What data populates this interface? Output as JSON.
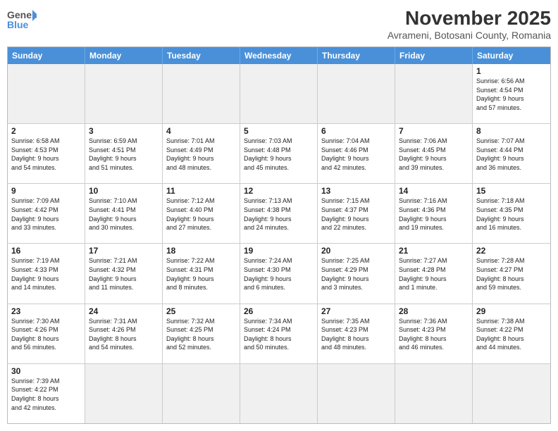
{
  "header": {
    "logo_general": "General",
    "logo_blue": "Blue",
    "title": "November 2025",
    "subtitle": "Avrameni, Botosani County, Romania"
  },
  "weekdays": [
    "Sunday",
    "Monday",
    "Tuesday",
    "Wednesday",
    "Thursday",
    "Friday",
    "Saturday"
  ],
  "cells": [
    {
      "day": "",
      "info": "",
      "empty": true
    },
    {
      "day": "",
      "info": "",
      "empty": true
    },
    {
      "day": "",
      "info": "",
      "empty": true
    },
    {
      "day": "",
      "info": "",
      "empty": true
    },
    {
      "day": "",
      "info": "",
      "empty": true
    },
    {
      "day": "",
      "info": "",
      "empty": true
    },
    {
      "day": "1",
      "info": "Sunrise: 6:56 AM\nSunset: 4:54 PM\nDaylight: 9 hours\nand 57 minutes.",
      "empty": false
    },
    {
      "day": "2",
      "info": "Sunrise: 6:58 AM\nSunset: 4:53 PM\nDaylight: 9 hours\nand 54 minutes.",
      "empty": false
    },
    {
      "day": "3",
      "info": "Sunrise: 6:59 AM\nSunset: 4:51 PM\nDaylight: 9 hours\nand 51 minutes.",
      "empty": false
    },
    {
      "day": "4",
      "info": "Sunrise: 7:01 AM\nSunset: 4:49 PM\nDaylight: 9 hours\nand 48 minutes.",
      "empty": false
    },
    {
      "day": "5",
      "info": "Sunrise: 7:03 AM\nSunset: 4:48 PM\nDaylight: 9 hours\nand 45 minutes.",
      "empty": false
    },
    {
      "day": "6",
      "info": "Sunrise: 7:04 AM\nSunset: 4:46 PM\nDaylight: 9 hours\nand 42 minutes.",
      "empty": false
    },
    {
      "day": "7",
      "info": "Sunrise: 7:06 AM\nSunset: 4:45 PM\nDaylight: 9 hours\nand 39 minutes.",
      "empty": false
    },
    {
      "day": "8",
      "info": "Sunrise: 7:07 AM\nSunset: 4:44 PM\nDaylight: 9 hours\nand 36 minutes.",
      "empty": false
    },
    {
      "day": "9",
      "info": "Sunrise: 7:09 AM\nSunset: 4:42 PM\nDaylight: 9 hours\nand 33 minutes.",
      "empty": false
    },
    {
      "day": "10",
      "info": "Sunrise: 7:10 AM\nSunset: 4:41 PM\nDaylight: 9 hours\nand 30 minutes.",
      "empty": false
    },
    {
      "day": "11",
      "info": "Sunrise: 7:12 AM\nSunset: 4:40 PM\nDaylight: 9 hours\nand 27 minutes.",
      "empty": false
    },
    {
      "day": "12",
      "info": "Sunrise: 7:13 AM\nSunset: 4:38 PM\nDaylight: 9 hours\nand 24 minutes.",
      "empty": false
    },
    {
      "day": "13",
      "info": "Sunrise: 7:15 AM\nSunset: 4:37 PM\nDaylight: 9 hours\nand 22 minutes.",
      "empty": false
    },
    {
      "day": "14",
      "info": "Sunrise: 7:16 AM\nSunset: 4:36 PM\nDaylight: 9 hours\nand 19 minutes.",
      "empty": false
    },
    {
      "day": "15",
      "info": "Sunrise: 7:18 AM\nSunset: 4:35 PM\nDaylight: 9 hours\nand 16 minutes.",
      "empty": false
    },
    {
      "day": "16",
      "info": "Sunrise: 7:19 AM\nSunset: 4:33 PM\nDaylight: 9 hours\nand 14 minutes.",
      "empty": false
    },
    {
      "day": "17",
      "info": "Sunrise: 7:21 AM\nSunset: 4:32 PM\nDaylight: 9 hours\nand 11 minutes.",
      "empty": false
    },
    {
      "day": "18",
      "info": "Sunrise: 7:22 AM\nSunset: 4:31 PM\nDaylight: 9 hours\nand 8 minutes.",
      "empty": false
    },
    {
      "day": "19",
      "info": "Sunrise: 7:24 AM\nSunset: 4:30 PM\nDaylight: 9 hours\nand 6 minutes.",
      "empty": false
    },
    {
      "day": "20",
      "info": "Sunrise: 7:25 AM\nSunset: 4:29 PM\nDaylight: 9 hours\nand 3 minutes.",
      "empty": false
    },
    {
      "day": "21",
      "info": "Sunrise: 7:27 AM\nSunset: 4:28 PM\nDaylight: 9 hours\nand 1 minute.",
      "empty": false
    },
    {
      "day": "22",
      "info": "Sunrise: 7:28 AM\nSunset: 4:27 PM\nDaylight: 8 hours\nand 59 minutes.",
      "empty": false
    },
    {
      "day": "23",
      "info": "Sunrise: 7:30 AM\nSunset: 4:26 PM\nDaylight: 8 hours\nand 56 minutes.",
      "empty": false
    },
    {
      "day": "24",
      "info": "Sunrise: 7:31 AM\nSunset: 4:26 PM\nDaylight: 8 hours\nand 54 minutes.",
      "empty": false
    },
    {
      "day": "25",
      "info": "Sunrise: 7:32 AM\nSunset: 4:25 PM\nDaylight: 8 hours\nand 52 minutes.",
      "empty": false
    },
    {
      "day": "26",
      "info": "Sunrise: 7:34 AM\nSunset: 4:24 PM\nDaylight: 8 hours\nand 50 minutes.",
      "empty": false
    },
    {
      "day": "27",
      "info": "Sunrise: 7:35 AM\nSunset: 4:23 PM\nDaylight: 8 hours\nand 48 minutes.",
      "empty": false
    },
    {
      "day": "28",
      "info": "Sunrise: 7:36 AM\nSunset: 4:23 PM\nDaylight: 8 hours\nand 46 minutes.",
      "empty": false
    },
    {
      "day": "29",
      "info": "Sunrise: 7:38 AM\nSunset: 4:22 PM\nDaylight: 8 hours\nand 44 minutes.",
      "empty": false
    },
    {
      "day": "30",
      "info": "Sunrise: 7:39 AM\nSunset: 4:22 PM\nDaylight: 8 hours\nand 42 minutes.",
      "empty": false
    },
    {
      "day": "",
      "info": "",
      "empty": true
    },
    {
      "day": "",
      "info": "",
      "empty": true
    },
    {
      "day": "",
      "info": "",
      "empty": true
    },
    {
      "day": "",
      "info": "",
      "empty": true
    },
    {
      "day": "",
      "info": "",
      "empty": true
    },
    {
      "day": "",
      "info": "",
      "empty": true
    }
  ]
}
